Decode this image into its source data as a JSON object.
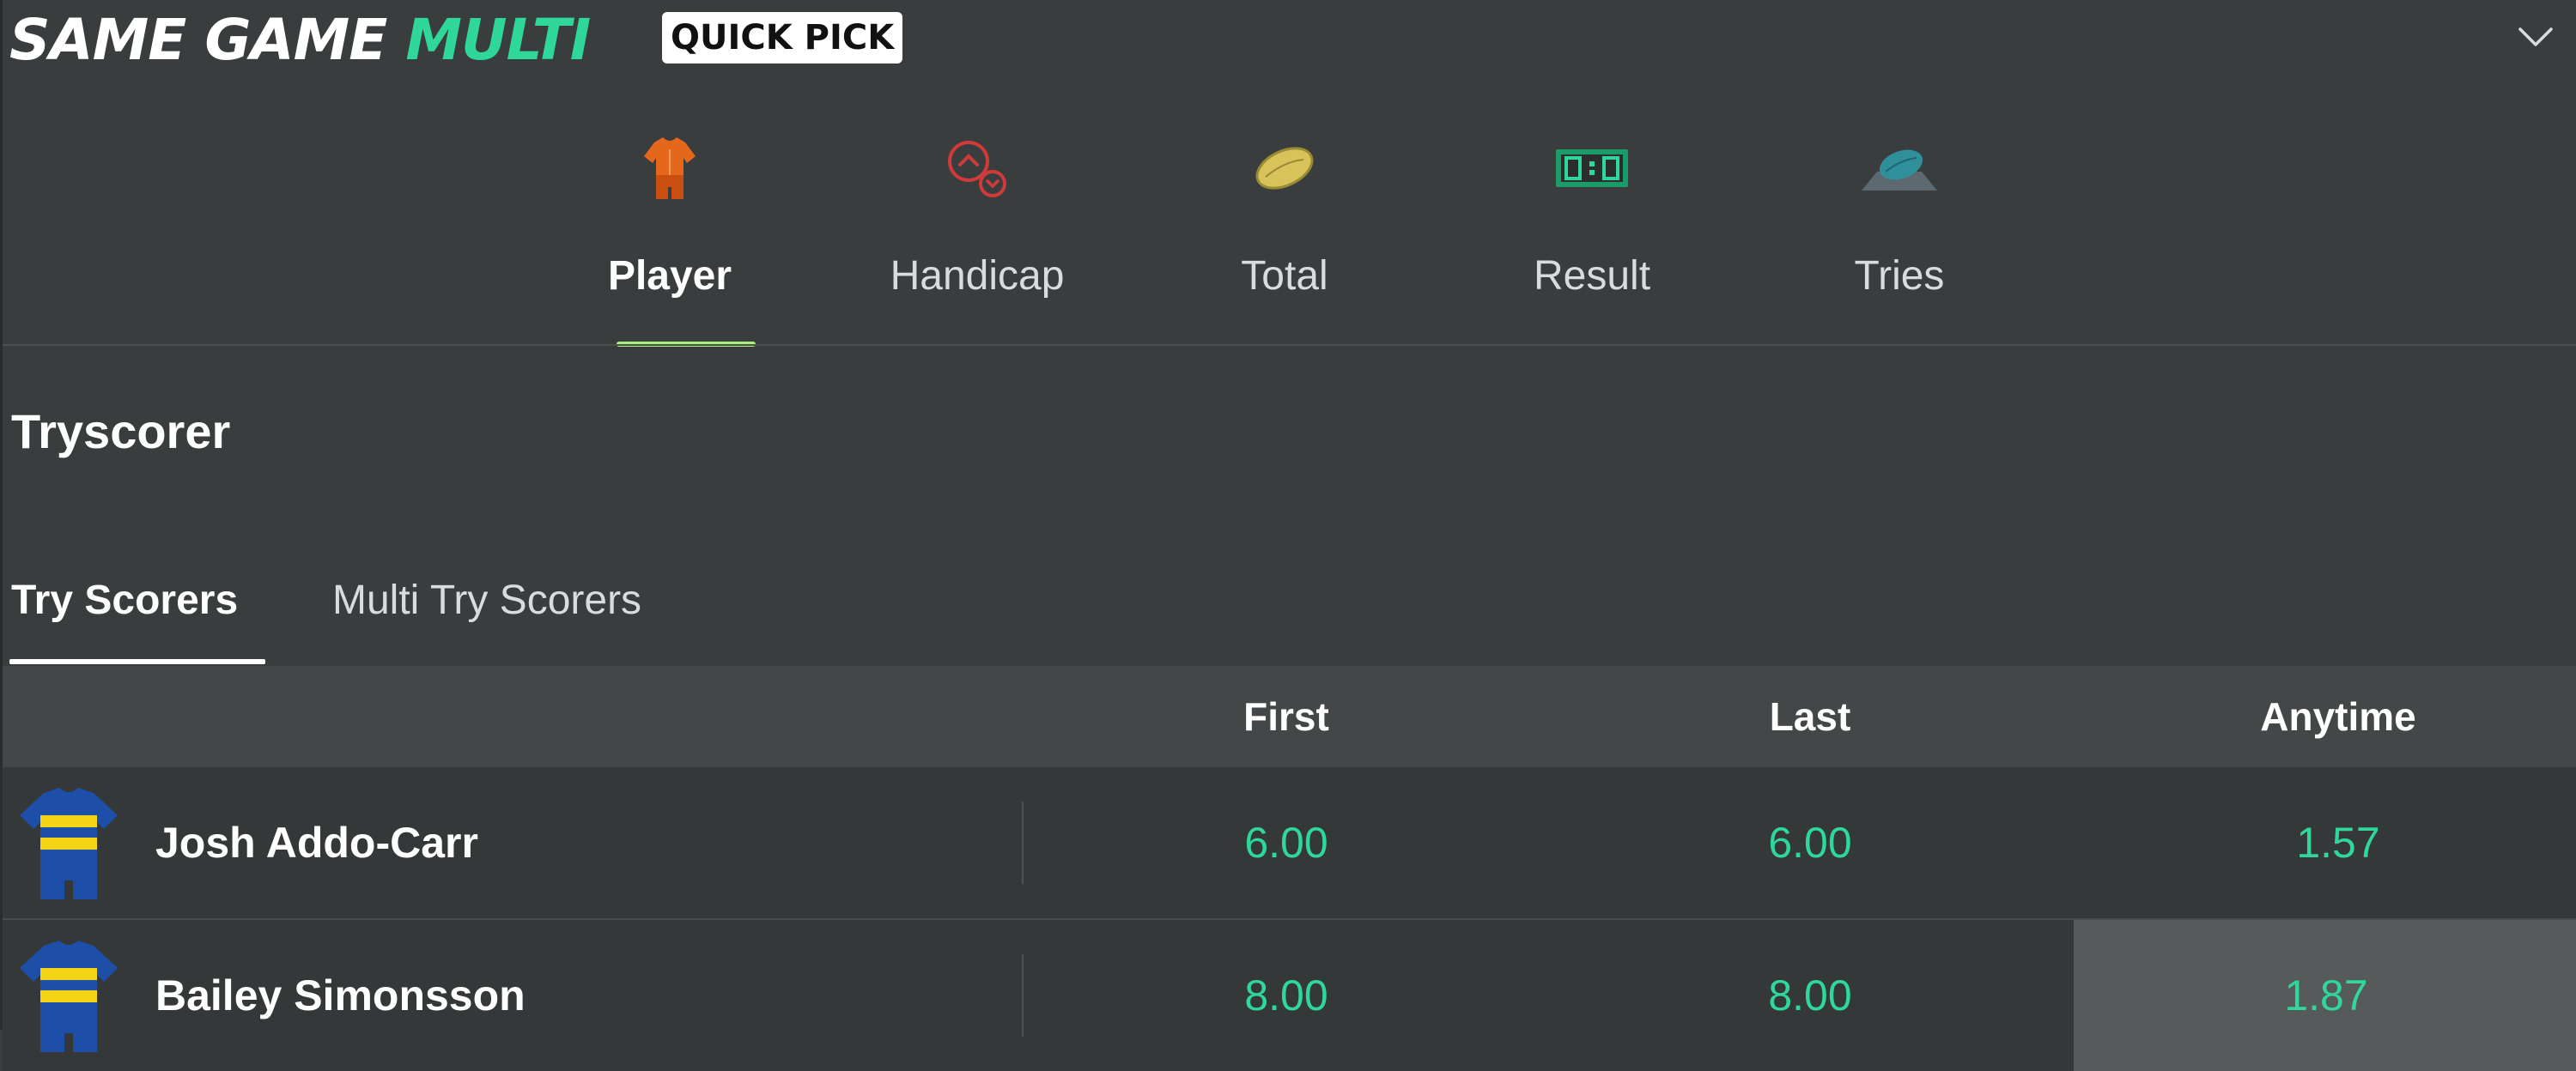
{
  "header": {
    "brand_part1": "SAME GAME",
    "brand_part2": "MULTI",
    "quick_pick": "QUICK PICK"
  },
  "categories": [
    {
      "label": "Player",
      "icon": "jersey-icon",
      "active": true
    },
    {
      "label": "Handicap",
      "icon": "handicap-icon",
      "active": false
    },
    {
      "label": "Total",
      "icon": "football-icon",
      "active": false
    },
    {
      "label": "Result",
      "icon": "scoreboard-icon",
      "active": false
    },
    {
      "label": "Tries",
      "icon": "try-ball-icon",
      "active": false
    }
  ],
  "section": {
    "title": "Tryscorer"
  },
  "sub_tabs": [
    {
      "label": "Try Scorers",
      "active": true
    },
    {
      "label": "Multi Try Scorers",
      "active": false
    }
  ],
  "table": {
    "columns": [
      "First",
      "Last",
      "Anytime"
    ],
    "rows": [
      {
        "player": "Josh Addo-Carr",
        "first": "6.00",
        "last": "6.00",
        "anytime": "1.57",
        "selected": "none"
      },
      {
        "player": "Bailey Simonsson",
        "first": "8.00",
        "last": "8.00",
        "anytime": "1.87",
        "selected": "anytime"
      }
    ]
  },
  "colors": {
    "background": "#3a3d3e",
    "accent_green": "#2fd79a",
    "tab_underline": "#a9f07c",
    "jersey_blue": "#1d4ea8",
    "jersey_yellow": "#f4d414"
  }
}
